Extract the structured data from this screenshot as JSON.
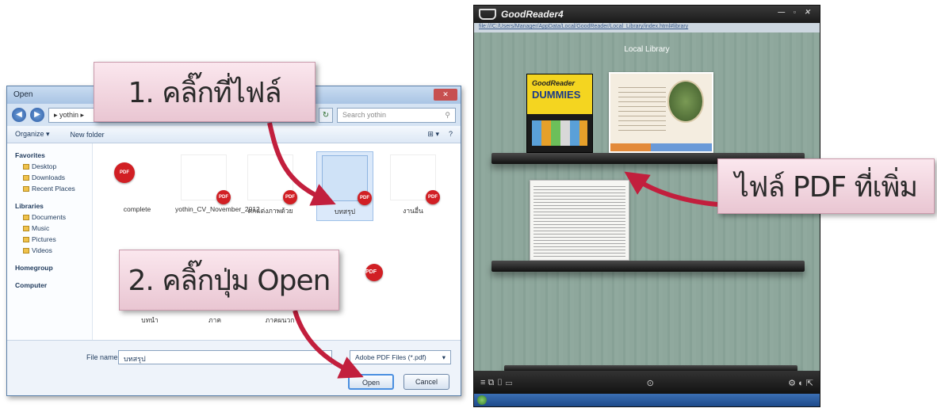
{
  "dialog": {
    "title": "Open",
    "close": "✕",
    "address": "▸ yothin ▸",
    "search_placeholder": "Search yothin",
    "toolbar": {
      "organize": "Organize ▾",
      "new_folder": "New folder",
      "view": "⊞ ▾",
      "help": "?"
    },
    "sidebar": {
      "favorites": "Favorites",
      "fav_items": [
        "Desktop",
        "Downloads",
        "Recent Places"
      ],
      "libraries": "Libraries",
      "lib_items": [
        "Documents",
        "Music",
        "Pictures",
        "Videos"
      ],
      "homegroup": "Homegroup",
      "computer": "Computer"
    },
    "files": [
      {
        "name": "complete"
      },
      {
        "name": "yothin_CV_November_2012"
      },
      {
        "name": "ตกแต่งภาพด้วย"
      },
      {
        "name": "บทสรุป"
      },
      {
        "name": "งานอื่น"
      }
    ],
    "files_row2": [
      {
        "name": "บทนำ"
      },
      {
        "name": "ภาค"
      },
      {
        "name": "ภาคผนวก"
      }
    ],
    "filename_label": "File name:",
    "filename_value": "บทสรุป",
    "filter": "Adobe PDF Files (*.pdf)",
    "open_label": "Open",
    "cancel_label": "Cancel",
    "pdf_badge": "PDF"
  },
  "callouts": {
    "step1": "1. คลิ๊กที่ไฟล์",
    "step2": "2. คลิ๊กปุ่ม Open",
    "note": "ไฟล์ PDF ที่เพิ่ม"
  },
  "goodreader": {
    "title": "GoodReader4",
    "window_controls": "— ▫ ✕",
    "url": "file:///C:/Users/Manager/AppData/Local/GoodReader/Local_Library/index.html#library",
    "library_label": "Local Library",
    "book1_line1": "GoodReader",
    "book1_line2": "DUMMIES",
    "bottom_left": "≡ ⧉ ▯ ▭",
    "bottom_mid": "⊙",
    "bottom_right": "⚙ ◐ ⇱"
  },
  "colors": {
    "callout_bg": "#f3d6df",
    "arrow": "#c21f3d",
    "pdf_red": "#d11f24"
  }
}
